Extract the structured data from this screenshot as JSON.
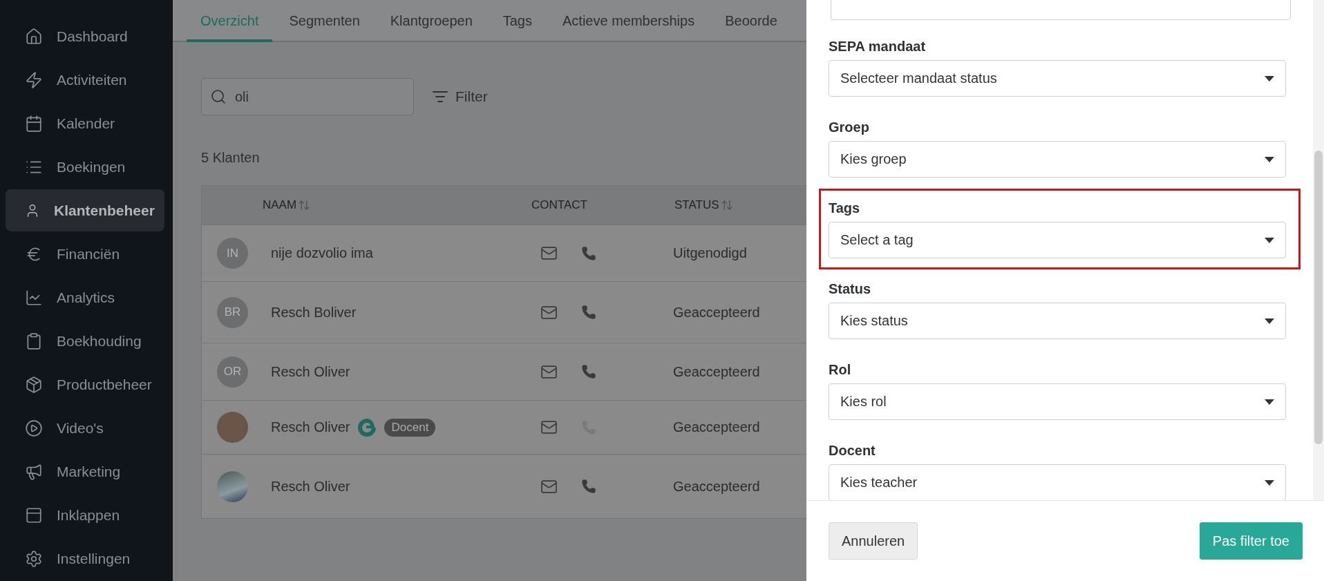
{
  "sidebar": {
    "items": [
      {
        "label": "Dashboard",
        "selected": false
      },
      {
        "label": "Activiteiten",
        "selected": false
      },
      {
        "label": "Kalender",
        "selected": false
      },
      {
        "label": "Boekingen",
        "selected": false
      },
      {
        "label": "Klantenbeheer",
        "selected": true
      },
      {
        "label": "Financiën",
        "selected": false
      },
      {
        "label": "Analytics",
        "selected": false
      },
      {
        "label": "Boekhouding",
        "selected": false
      },
      {
        "label": "Productbeheer",
        "selected": false
      },
      {
        "label": "Video's",
        "selected": false
      },
      {
        "label": "Marketing",
        "selected": false
      },
      {
        "label": "Inklappen",
        "selected": false
      },
      {
        "label": "Instellingen",
        "selected": false
      }
    ]
  },
  "tabs": [
    {
      "label": "Overzicht",
      "selected": true
    },
    {
      "label": "Segmenten",
      "selected": false
    },
    {
      "label": "Klantgroepen",
      "selected": false
    },
    {
      "label": "Tags",
      "selected": false
    },
    {
      "label": "Actieve memberships",
      "selected": false
    },
    {
      "label": "Beoorde",
      "selected": false
    }
  ],
  "search": {
    "value": "oli"
  },
  "filter_button": {
    "label": "Filter"
  },
  "count": "5 Klanten",
  "table": {
    "columns": [
      {
        "label": "NAAM",
        "sortable": true
      },
      {
        "label": "CONTACT",
        "sortable": false
      },
      {
        "label": "STATUS",
        "sortable": true
      }
    ],
    "rows": [
      {
        "avatar": {
          "kind": "initials",
          "text": "IN"
        },
        "name": "nije dozvolio ima",
        "phone_available": true,
        "status": "Uitgenodigd"
      },
      {
        "avatar": {
          "kind": "initials",
          "text": "BR"
        },
        "name": "Resch Boliver",
        "phone_available": true,
        "status": "Geaccepteerd"
      },
      {
        "avatar": {
          "kind": "initials",
          "text": "OR"
        },
        "name": "Resch Oliver",
        "phone_available": true,
        "status": "Geaccepteerd"
      },
      {
        "avatar": {
          "kind": "photo"
        },
        "name": "Resch Oliver",
        "logo": true,
        "badge": "Docent",
        "phone_available": false,
        "status": "Geaccepteerd"
      },
      {
        "avatar": {
          "kind": "landscape"
        },
        "name": "Resch Oliver",
        "phone_available": true,
        "status": "Geaccepteerd"
      }
    ]
  },
  "filter_panel": {
    "filters": [
      {
        "label": "SEPA mandaat",
        "placeholder": "Selecteer mandaat status",
        "highlighted": false
      },
      {
        "label": "Groep",
        "placeholder": "Kies groep",
        "highlighted": false
      },
      {
        "label": "Tags",
        "placeholder": "Select a tag",
        "highlighted": true
      },
      {
        "label": "Status",
        "placeholder": "Kies status",
        "highlighted": false
      },
      {
        "label": "Rol",
        "placeholder": "Kies rol",
        "highlighted": false
      },
      {
        "label": "Docent",
        "placeholder": "Kies teacher",
        "highlighted": false
      }
    ],
    "cancel_button": "Annuleren",
    "apply_button": "Pas filter toe"
  }
}
